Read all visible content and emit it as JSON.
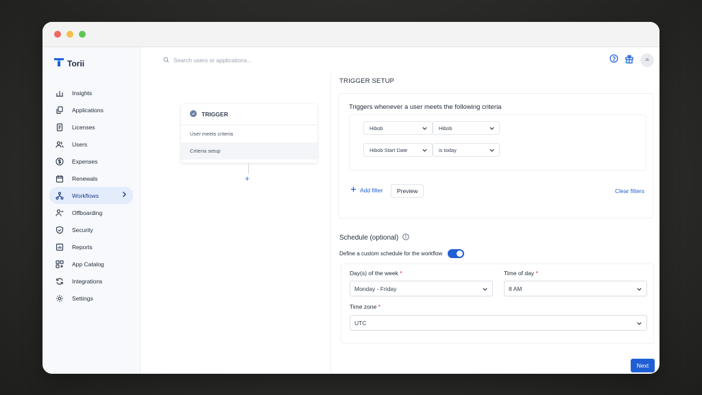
{
  "window": {
    "traffic_lights": [
      "#ed6a5e",
      "#f4bf4f",
      "#61c554"
    ]
  },
  "brand": {
    "name": "Torii",
    "accent": "#1f5fd6"
  },
  "search": {
    "placeholder": "Search users or applications..."
  },
  "user": {
    "initials": "JE"
  },
  "sidebar": {
    "items": [
      {
        "label": "Insights",
        "icon": "bar-chart-icon"
      },
      {
        "label": "Applications",
        "icon": "copy-icon"
      },
      {
        "label": "Licenses",
        "icon": "document-icon"
      },
      {
        "label": "Users",
        "icon": "users-icon"
      },
      {
        "label": "Expenses",
        "icon": "dollar-icon"
      },
      {
        "label": "Renewals",
        "icon": "calendar-icon"
      },
      {
        "label": "Workflows",
        "icon": "workflow-icon",
        "active": true
      },
      {
        "label": "Offboarding",
        "icon": "user-minus-icon"
      },
      {
        "label": "Security",
        "icon": "shield-icon"
      },
      {
        "label": "Reports",
        "icon": "report-icon"
      },
      {
        "label": "App Catalog",
        "icon": "grid-plus-icon"
      },
      {
        "label": "Integrations",
        "icon": "refresh-icon"
      },
      {
        "label": "Settings",
        "icon": "gear-icon"
      }
    ]
  },
  "trigger_card": {
    "title": "TRIGGER",
    "rows": [
      "User meets criteria",
      "Criteria setup"
    ]
  },
  "panel": {
    "title": "TRIGGER SETUP",
    "criteria_title": "Triggers whenever a user meets the following criteria",
    "filters": [
      {
        "field": "Hibob",
        "value": "Hibob"
      },
      {
        "field": "Hibob Start Date",
        "value": "is today"
      }
    ],
    "add_filter": "Add filter",
    "preview": "Preview",
    "clear_filters": "Clear filters",
    "schedule_title": "Schedule (optional)",
    "custom_schedule_label": "Define a custom schedule for the workflow",
    "custom_schedule_enabled": true,
    "days_label": "Day(s) of the week",
    "days_value": "Monday - Friday",
    "time_label": "Time of day",
    "time_value": "8 AM",
    "timezone_label": "Time zone",
    "timezone_value": "UTC",
    "required_mark": "*",
    "next": "Next"
  }
}
